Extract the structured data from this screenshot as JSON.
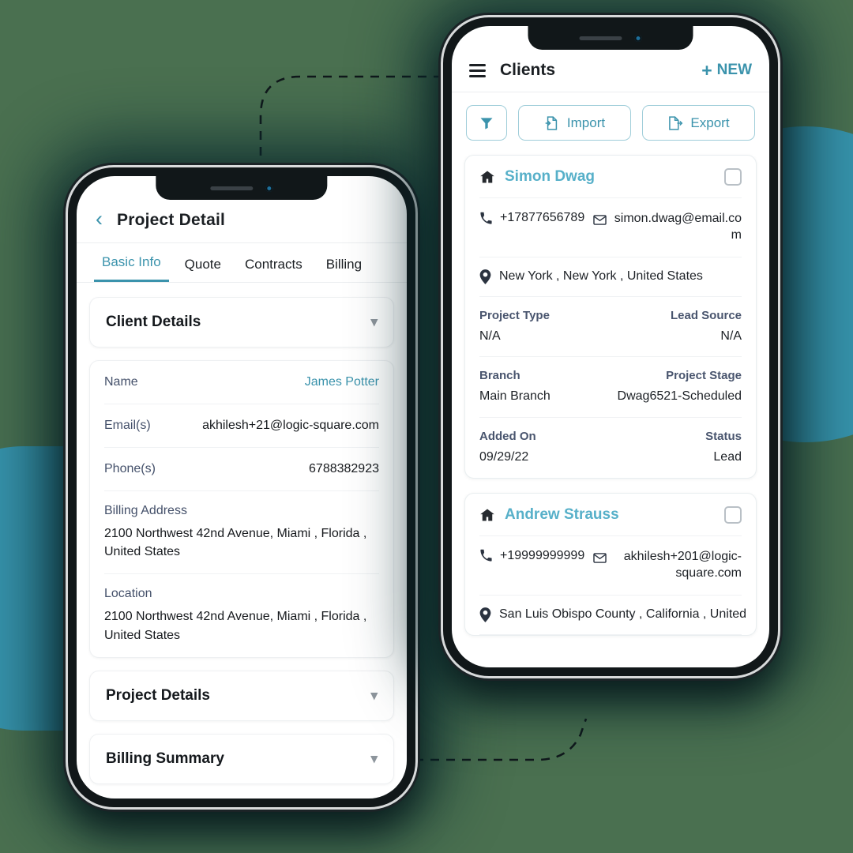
{
  "theme": {
    "background": "#4a7050",
    "blob": "#3794ad",
    "accent": "#3b93ac",
    "accent_light": "#57b0c9",
    "label": "#44506a",
    "text": "#1d2126"
  },
  "phone_left": {
    "name": "project-detail-phone",
    "appbar": {
      "back_icon": "chevron-left-icon",
      "title": "Project Detail"
    },
    "tabs": [
      {
        "label": "Basic Info",
        "active": true
      },
      {
        "label": "Quote",
        "active": false
      },
      {
        "label": "Contracts",
        "active": false
      },
      {
        "label": "Billing",
        "active": false
      }
    ],
    "sections": [
      {
        "title": "Client Details",
        "chevron": "chevron-down-icon",
        "expanded": true
      },
      {
        "title": "Project Details",
        "chevron": "chevron-down-icon",
        "expanded": false
      },
      {
        "title": "Billing Summary",
        "chevron": "chevron-down-icon",
        "expanded": false
      }
    ],
    "client_details": {
      "rows": [
        {
          "key": "Name",
          "value": "James Potter",
          "accent": true
        },
        {
          "key": "Email(s)",
          "value": "akhilesh+21@logic-square.com",
          "accent": false
        },
        {
          "key": "Phone(s)",
          "value": "6788382923",
          "accent": false
        }
      ],
      "blocks": [
        {
          "key": "Billing Address",
          "value": "2100 Northwest 42nd Avenue, Miami , Florida , United States"
        },
        {
          "key": "Location",
          "value": "2100 Northwest 42nd Avenue, Miami , Florida , United States"
        }
      ]
    }
  },
  "phone_right": {
    "name": "clients-phone",
    "appbar": {
      "menu_icon": "hamburger-menu-icon",
      "title": "Clients",
      "new_plus": "+",
      "new_label": "NEW"
    },
    "toolbar": {
      "filter_icon": "filter-funnel-icon",
      "import_icon": "document-import-icon",
      "import_label": "Import",
      "export_icon": "document-export-icon",
      "export_label": "Export"
    },
    "clients": [
      {
        "icon": "home-icon",
        "name": "Simon Dwag",
        "checkbox_icon": "checkbox-unchecked-icon",
        "phone_icon": "phone-icon",
        "phone": "+17877656789",
        "email_icon": "envelope-icon",
        "email": "simon.dwag@email.com",
        "location_icon": "map-pin-icon",
        "location": "New York , New York , United States",
        "pairs": [
          {
            "key_left": "Project Type",
            "val_left": "N/A",
            "key_right": "Lead Source",
            "val_right": "N/A"
          },
          {
            "key_left": "Branch",
            "val_left": "Main Branch",
            "key_right": "Project Stage",
            "val_right": "Dwag6521-Scheduled"
          },
          {
            "key_left": "Added On",
            "val_left": "09/29/22",
            "key_right": "Status",
            "val_right": "Lead"
          }
        ]
      },
      {
        "icon": "home-icon",
        "name": "Andrew Strauss",
        "checkbox_icon": "checkbox-unchecked-icon",
        "phone_icon": "phone-icon",
        "phone": "+19999999999",
        "email_icon": "envelope-icon",
        "email": "akhilesh+201@logic-square.com",
        "location_icon": "map-pin-icon",
        "location": "San Luis Obispo County , California , United"
      }
    ]
  }
}
